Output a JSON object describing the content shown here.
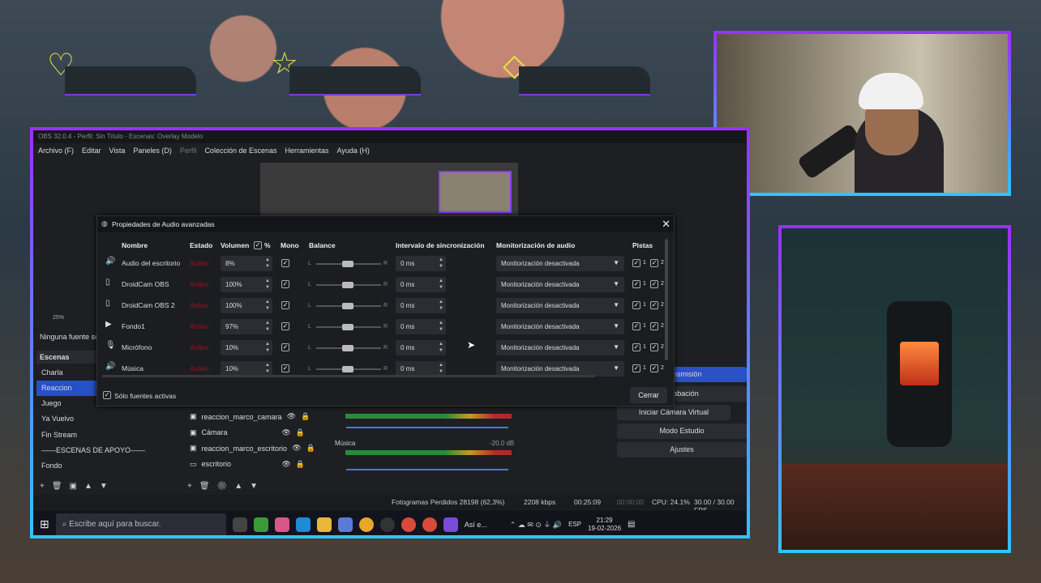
{
  "obs_window": {
    "title": "OBS 32.0.4 - Perfil: Sin Título - Escenas: Overlay Modelo",
    "menu": [
      "Archivo (F)",
      "Editar",
      "Vista",
      "Paneles (D)",
      "Perfil",
      "Colección de Escenas",
      "Herramientas",
      "Ayuda (H)"
    ]
  },
  "dialog": {
    "title": "Propiedades de Audio avanzadas",
    "close": "✕",
    "headers": {
      "name": "Nombre",
      "status": "Estado",
      "volume": "Volumen",
      "percent": "%",
      "mono": "Mono",
      "balance": "Balance",
      "sync": "Intervalo de sincronización",
      "monitoring": "Monitorización de audio",
      "tracks": "Pistas"
    },
    "rows": [
      {
        "icon": "speaker-icon",
        "name": "Audio del escritorio",
        "status": "Activo",
        "volume": "8%",
        "sync": "0 ms",
        "monitoring": "Monitorización desactivada"
      },
      {
        "icon": "file-icon",
        "name": "DroidCam OBS",
        "status": "Activo",
        "volume": "100%",
        "sync": "0 ms",
        "monitoring": "Monitorización desactivada"
      },
      {
        "icon": "file-icon",
        "name": "DroidCam OBS 2",
        "status": "Activo",
        "volume": "100%",
        "sync": "0 ms",
        "monitoring": "Monitorización desactivada"
      },
      {
        "icon": "play-icon",
        "name": "Fondo1",
        "status": "Activo",
        "volume": "97%",
        "sync": "0 ms",
        "monitoring": "Monitorización desactivada"
      },
      {
        "icon": "mic-icon",
        "name": "Micrófono",
        "status": "Activo",
        "volume": "10%",
        "sync": "0 ms",
        "monitoring": "Monitorización desactivada"
      },
      {
        "icon": "speaker-icon",
        "name": "Música",
        "status": "Activo",
        "volume": "10%",
        "sync": "0 ms",
        "monitoring": "Monitorización desactivada"
      }
    ],
    "balance_left": "L",
    "balance_right": "R",
    "track_labels": [
      "1",
      "2"
    ],
    "active_only_label": "Sólo fuentes activas",
    "close_button": "Cerrar"
  },
  "left": {
    "zoom": "25%",
    "no_source": "Ninguna fuente sel",
    "scenes_title": "Escenas",
    "scenes": [
      "Charla",
      "Reaccion",
      "Juego",
      "Ya Vuelvo",
      "Fin Stream",
      "——ESCENAS DE APOYO——",
      "Fondo"
    ],
    "selected_scene": 1
  },
  "sources": [
    "reaccion_marco_camara",
    "Cámara",
    "reaccion_marco_escritorio",
    "escritorio"
  ],
  "mixer": {
    "music_label": "Música",
    "music_db": "-20.0 dB"
  },
  "controls": {
    "stream": "Transmisión",
    "record": "Grabación",
    "virtual_cam": "Iniciar Cámara Virtual",
    "studio": "Modo Estudio",
    "settings": "Ajustes"
  },
  "status": {
    "dropped": "Fotogramas Perdidos 28198 (62,3%)",
    "bitrate": "2208 kbps",
    "stream_time": "00:25:09",
    "rec_time": "00:00:00",
    "cpu": "CPU: 24.1%",
    "fps": "30.00 / 30.00 FPS"
  },
  "taskbar": {
    "search_placeholder": "Escribe aquí para buscar.",
    "lang": "ESP",
    "time": "21:29",
    "date": "19-02-2026",
    "app_short": "Así e..."
  },
  "colors": {
    "accent_purple": "#9b30ff",
    "accent_cyan": "#2fc4ff",
    "obs_blue": "#2451c7",
    "status_red": "#a01515"
  }
}
